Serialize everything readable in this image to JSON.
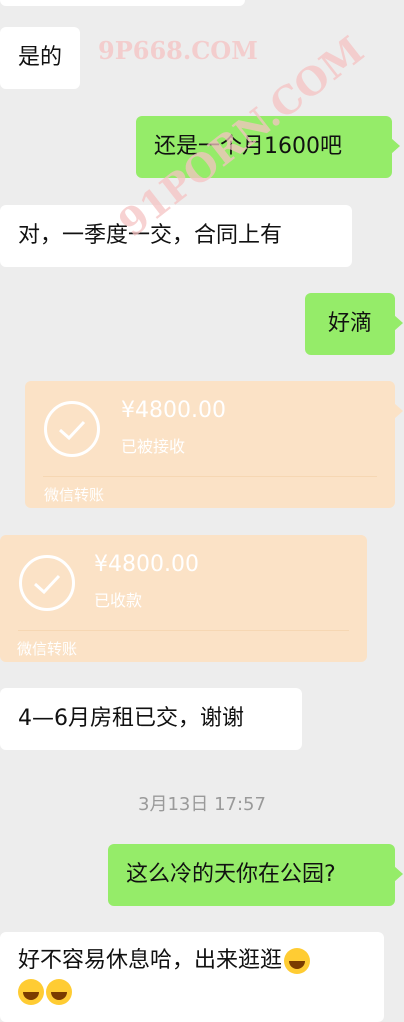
{
  "messages": [
    {
      "side": "left",
      "text": "是的"
    },
    {
      "side": "right",
      "text": "还是一个月1600吧"
    },
    {
      "side": "left",
      "text": "对，一季度一交，合同上有"
    },
    {
      "side": "right",
      "text": "好滴"
    },
    {
      "side": "right",
      "type": "transfer",
      "amount": "¥4800.00",
      "status": "已被接收",
      "footer": "微信转账"
    },
    {
      "side": "left",
      "type": "transfer",
      "amount": "¥4800.00",
      "status": "已收款",
      "footer": "微信转账"
    },
    {
      "side": "left",
      "text": "4—6月房租已交，谢谢"
    },
    {
      "side": "right",
      "text": "这么冷的天你在公园?"
    },
    {
      "side": "left",
      "text": "好不容易休息哈，出来逛逛"
    }
  ],
  "timestamp": "3月13日 17:57",
  "watermarks": [
    "9P668.COM",
    "91PORN.COM"
  ],
  "emoji_names": [
    "laughing-tears-emoji",
    "grinning-emoji"
  ],
  "colors": {
    "background": "#ededed",
    "left_bubble": "#ffffff",
    "right_bubble": "#95ec69",
    "transfer": "#fbe2c6"
  }
}
